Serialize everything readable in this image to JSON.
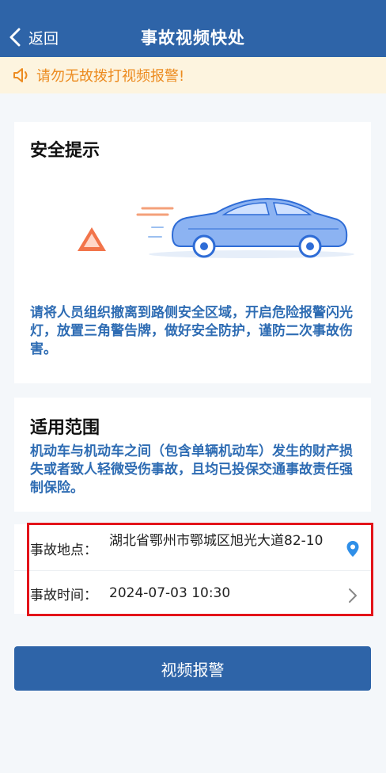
{
  "header": {
    "back_label": "返回",
    "title": "事故视频快处"
  },
  "notice": {
    "icon": "speaker-icon",
    "text": "请勿无故拨打视频报警!"
  },
  "safety": {
    "title": "安全提示",
    "text": "请将人员组织撤离到路侧安全区域，开启危险报警闪光灯，放置三角警告牌，做好安全防护，谨防二次事故伤害。"
  },
  "scope": {
    "title": "适用范围",
    "text": "机动车与机动车之间（包含单辆机动车）发生的财产损失或者致人轻微受伤事故，且均已投保交通事故责任强制保险。"
  },
  "incident": {
    "location_label": "事故地点：",
    "location_value": "湖北省鄂州市鄂城区旭光大道82-10",
    "time_label": "事故时间：",
    "time_value": "2024-07-03 10:30"
  },
  "actions": {
    "submit_label": "视频报警"
  },
  "colors": {
    "primary": "#2e64a8",
    "notice_bg": "#fdf4df",
    "notice_text": "#ec8b20",
    "highlight": "#e3141a",
    "info_text": "#2e6cb3"
  }
}
